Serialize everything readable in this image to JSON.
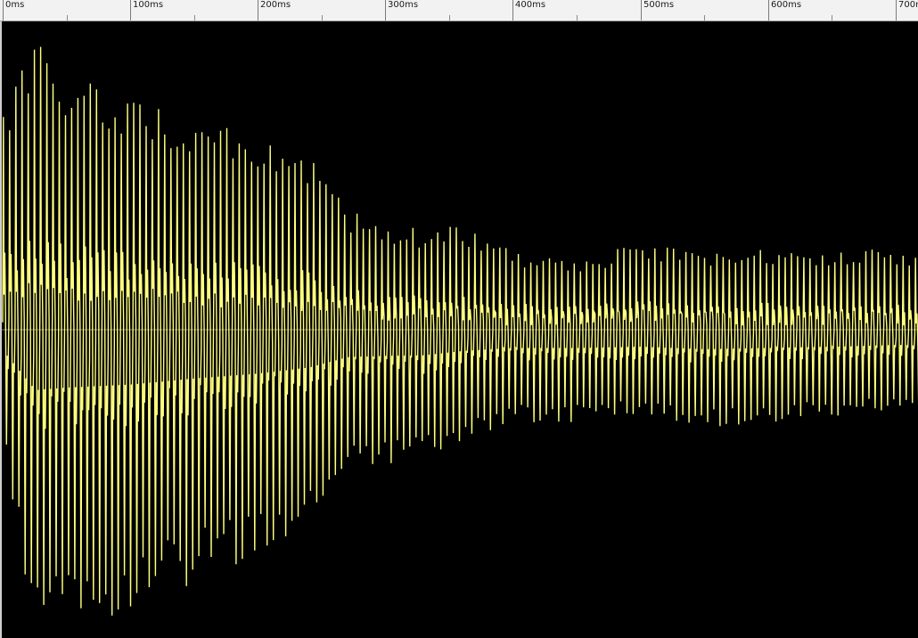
{
  "ruler": {
    "ticks": [
      "0ms",
      "100ms",
      "200ms",
      "300ms",
      "400ms",
      "500ms",
      "600ms",
      "700ms"
    ],
    "minor_divisions": 2
  },
  "waveform": {
    "color": "#ffff80",
    "background": "#000000",
    "centerline_color": "#ffffff",
    "duration_ms": 720,
    "cycles": 148,
    "envelope": [
      {
        "t_ms": 0,
        "upper": 0.72,
        "lower": -0.35
      },
      {
        "t_ms": 25,
        "upper": 0.92,
        "lower": -0.99
      },
      {
        "t_ms": 50,
        "upper": 0.8,
        "lower": -0.95
      },
      {
        "t_ms": 100,
        "upper": 0.78,
        "lower": -0.9
      },
      {
        "t_ms": 150,
        "upper": 0.66,
        "lower": -0.8
      },
      {
        "t_ms": 200,
        "upper": 0.62,
        "lower": -0.72
      },
      {
        "t_ms": 240,
        "upper": 0.55,
        "lower": -0.62
      },
      {
        "t_ms": 270,
        "upper": 0.38,
        "lower": -0.45
      },
      {
        "t_ms": 300,
        "upper": 0.35,
        "lower": -0.43
      },
      {
        "t_ms": 330,
        "upper": 0.32,
        "lower": -0.42
      },
      {
        "t_ms": 360,
        "upper": 0.33,
        "lower": -0.35
      },
      {
        "t_ms": 400,
        "upper": 0.25,
        "lower": -0.3
      },
      {
        "t_ms": 450,
        "upper": 0.22,
        "lower": -0.3
      },
      {
        "t_ms": 500,
        "upper": 0.28,
        "lower": -0.28
      },
      {
        "t_ms": 550,
        "upper": 0.24,
        "lower": -0.32
      },
      {
        "t_ms": 600,
        "upper": 0.26,
        "lower": -0.3
      },
      {
        "t_ms": 650,
        "upper": 0.25,
        "lower": -0.28
      },
      {
        "t_ms": 700,
        "upper": 0.26,
        "lower": -0.25
      },
      {
        "t_ms": 720,
        "upper": 0.24,
        "lower": -0.26
      }
    ]
  }
}
